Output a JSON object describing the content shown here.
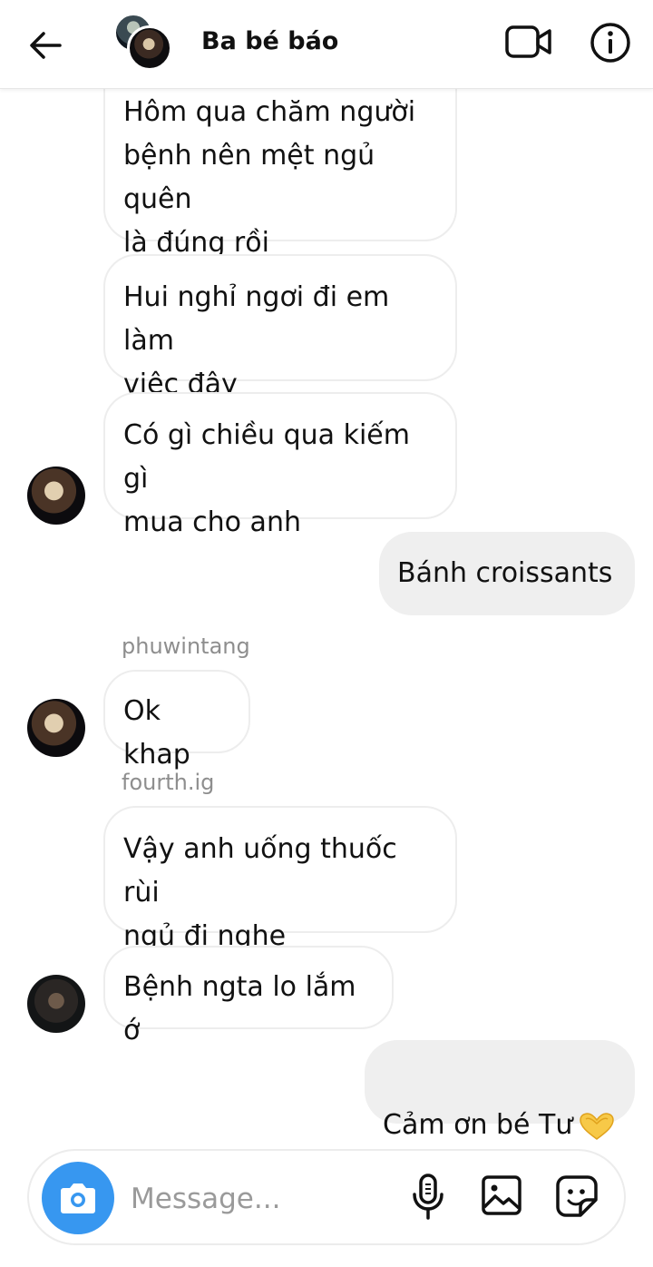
{
  "header": {
    "title": "Ba bé báo",
    "icons": {
      "back": "arrow-left-icon",
      "video": "video-camera-icon",
      "info": "info-icon"
    }
  },
  "messages": [
    {
      "sender": "",
      "direction": "in",
      "text": "Hôm qua chăm người\nbệnh nên mệt ngủ quên\nlà đúng rồi"
    },
    {
      "sender": "",
      "direction": "in",
      "text": "Hui nghỉ ngơi đi em làm\nviệc đây"
    },
    {
      "sender": "",
      "direction": "in",
      "text": "Có gì chiều qua kiếm gì\nmua cho anh"
    },
    {
      "sender": "",
      "direction": "out",
      "text": "Bánh croissants"
    },
    {
      "sender": "phuwintang",
      "direction": "in",
      "text": "Ok khap"
    },
    {
      "sender": "fourth.ig",
      "direction": "in",
      "text": "Vậy anh uống thuốc rùi\nngủ đi nghe"
    },
    {
      "sender": "",
      "direction": "in",
      "text": "Bệnh ngta lo lắm ớ"
    },
    {
      "sender": "",
      "direction": "out",
      "text": "Cảm ơn bé Tư",
      "emoji": "heart-hands-emoji"
    }
  ],
  "composer": {
    "placeholder": "Message...",
    "value": "",
    "icons": {
      "camera": "camera-icon",
      "mic": "microphone-icon",
      "gallery": "image-icon",
      "sticker": "sticker-icon"
    },
    "accent": "#3797f0"
  },
  "colors": {
    "incoming_border": "#ededed",
    "outgoing_bg": "#efefef",
    "sender_label": "#8e8e8e"
  }
}
